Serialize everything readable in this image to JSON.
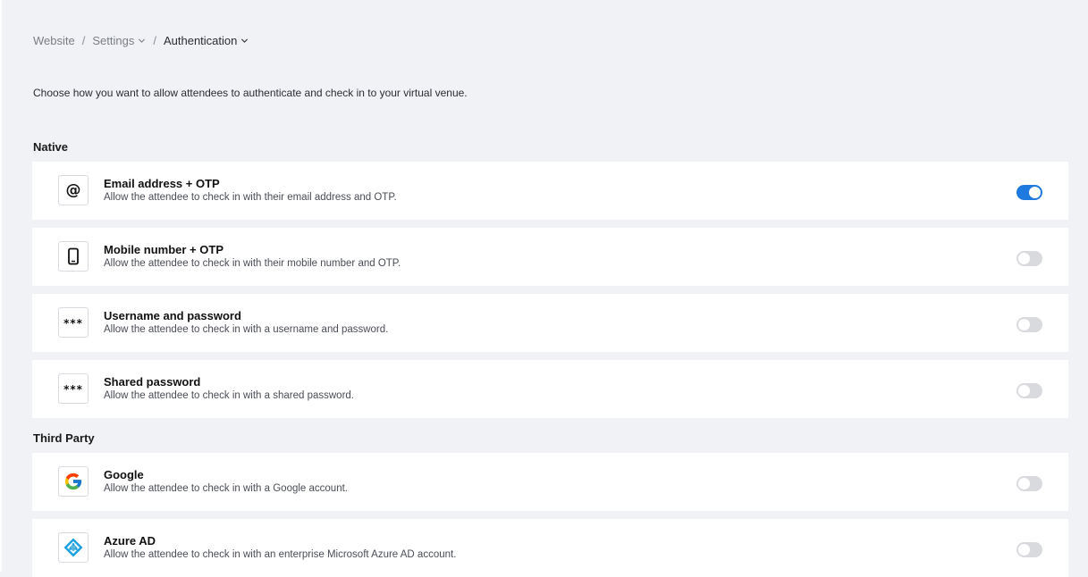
{
  "breadcrumb": {
    "items": [
      {
        "label": "Website",
        "has_dropdown": false
      },
      {
        "label": "Settings",
        "has_dropdown": true
      },
      {
        "label": "Authentication",
        "has_dropdown": true
      }
    ],
    "separator": "/"
  },
  "intro": "Choose how you want to allow attendees to authenticate and check in to your virtual venue.",
  "sections": {
    "native": "Native",
    "third_party": "Third Party"
  },
  "methods": [
    {
      "title": "Email address + OTP",
      "description": "Allow the attendee to check in with their email address and OTP.",
      "icon": "at-sign-icon",
      "enabled": true
    },
    {
      "title": "Mobile number + OTP",
      "description": "Allow the attendee to check in with their mobile number and OTP.",
      "icon": "mobile-phone-icon",
      "enabled": false
    },
    {
      "title": "Username and password",
      "description": "Allow the attendee to check in with a username and password.",
      "icon": "password-dots-icon",
      "enabled": false
    },
    {
      "title": "Shared password",
      "description": "Allow the attendee to check in with a shared password.",
      "icon": "password-dots-icon",
      "enabled": false
    },
    {
      "title": "Google",
      "description": "Allow the attendee to check in with a Google account.",
      "icon": "google-logo-icon",
      "enabled": false
    },
    {
      "title": "Azure AD",
      "description": "Allow the attendee to check in with an enterprise Microsoft Azure AD account.",
      "icon": "azure-ad-logo-icon",
      "enabled": false
    }
  ],
  "icon_text": {
    "at": "@",
    "dots": "***"
  },
  "colors": {
    "background": "#f1f2f6",
    "card": "#ffffff",
    "toggle_on": "#1f7ae0",
    "toggle_off": "#d9dadd",
    "azure": "#1ba1e2"
  }
}
